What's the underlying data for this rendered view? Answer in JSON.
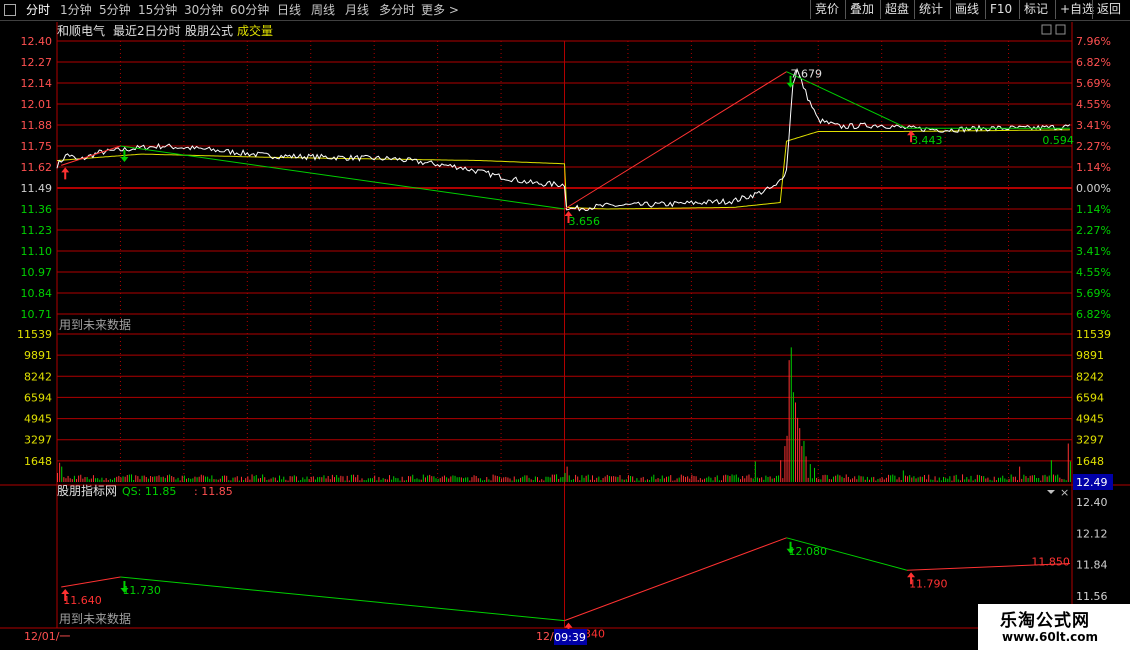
{
  "toolbar": {
    "left": [
      {
        "label": "分时",
        "active": true
      },
      {
        "label": "1分钟"
      },
      {
        "label": "5分钟"
      },
      {
        "label": "15分钟"
      },
      {
        "label": "30分钟"
      },
      {
        "label": "60分钟"
      },
      {
        "label": "日线"
      },
      {
        "label": "周线"
      },
      {
        "label": "月线"
      },
      {
        "label": "多分时"
      },
      {
        "label": "更多 >"
      }
    ],
    "right": [
      "竞价",
      "叠加",
      "超盘",
      "统计",
      "画线",
      "F10",
      "标记",
      "+自选",
      "返回"
    ]
  },
  "header": {
    "stock": "和顺电气",
    "period": "最近2日分时",
    "formula": "股朋公式",
    "volume_label": "成交量"
  },
  "future_data_label": "用到未来数据",
  "indicator": {
    "name": "股朋指标网",
    "qs_label": "QS: 11.85",
    "qs_value": "11.85"
  },
  "time_axis": {
    "day1": "12/01/一",
    "day2": "12/0",
    "cursor": "09:39"
  },
  "watermark": {
    "title": "乐淘公式网",
    "url": "www.60lt.com"
  },
  "colors": {
    "up": "#ff3232",
    "down": "#00d000",
    "grid": "#b00000",
    "price": "#ffffff",
    "avg": "#e0e000",
    "axis_text": "#ff5050"
  },
  "chart_data": [
    {
      "type": "line",
      "name_panel": "price",
      "ylim": [
        10.71,
        12.4
      ],
      "y_ticks": [
        "12.40",
        "12.27",
        "12.14",
        "12.01",
        "11.88",
        "11.75",
        "11.62",
        "11.49",
        "11.36",
        "11.23",
        "11.10",
        "10.97",
        "10.84",
        "10.71"
      ],
      "pct_ticks": [
        "7.96%",
        "6.82%",
        "5.69%",
        "4.55%",
        "3.41%",
        "2.27%",
        "1.14%",
        "0.00%",
        "1.14%",
        "2.27%",
        "3.41%",
        "4.55%",
        "5.69%",
        "6.82%"
      ],
      "prev_close": 11.49,
      "x_range": [
        0,
        480
      ],
      "price_key": [
        [
          0,
          11.63
        ],
        [
          5,
          11.7
        ],
        [
          10,
          11.66
        ],
        [
          20,
          11.71
        ],
        [
          40,
          11.74
        ],
        [
          50,
          11.75
        ],
        [
          70,
          11.73
        ],
        [
          100,
          11.69
        ],
        [
          130,
          11.68
        ],
        [
          160,
          11.67
        ],
        [
          190,
          11.62
        ],
        [
          210,
          11.56
        ],
        [
          225,
          11.52
        ],
        [
          240,
          11.51
        ],
        [
          241,
          11.37
        ],
        [
          243,
          11.36
        ],
        [
          260,
          11.38
        ],
        [
          290,
          11.39
        ],
        [
          320,
          11.41
        ],
        [
          330,
          11.45
        ],
        [
          340,
          11.5
        ],
        [
          345,
          11.6
        ],
        [
          348,
          12.14
        ],
        [
          350,
          12.22
        ],
        [
          355,
          12.05
        ],
        [
          360,
          11.91
        ],
        [
          370,
          11.87
        ],
        [
          390,
          11.88
        ],
        [
          402,
          11.86
        ],
        [
          420,
          11.85
        ],
        [
          440,
          11.86
        ],
        [
          460,
          11.86
        ],
        [
          479,
          11.87
        ]
      ],
      "avg_key": [
        [
          0,
          11.66
        ],
        [
          40,
          11.7
        ],
        [
          100,
          11.68
        ],
        [
          200,
          11.66
        ],
        [
          240,
          11.64
        ],
        [
          241,
          11.37
        ],
        [
          260,
          11.36
        ],
        [
          320,
          11.37
        ],
        [
          342,
          11.4
        ],
        [
          345,
          11.78
        ],
        [
          360,
          11.84
        ],
        [
          400,
          11.84
        ],
        [
          479,
          11.85
        ]
      ],
      "zigzag": [
        [
          2,
          11.63
        ],
        [
          30,
          11.75
        ],
        [
          240,
          11.36
        ],
        [
          345,
          12.21
        ],
        [
          402,
          11.86
        ],
        [
          479,
          11.86
        ]
      ],
      "zigzag_labels": [
        {
          "x": 240,
          "label": "3.656"
        },
        {
          "x": 345,
          "label": "7.679"
        },
        {
          "x": 402,
          "label": "3.443"
        },
        {
          "x": 479,
          "label": "0.594"
        }
      ],
      "buy_arrows": [
        2,
        240,
        402
      ],
      "sell_arrows": [
        30,
        345
      ]
    },
    {
      "type": "bar",
      "name_panel": "volume",
      "ylim": [
        0,
        11539
      ],
      "y_ticks": [
        "11539",
        "9891",
        "8242",
        "6594",
        "4945",
        "3297",
        "1648"
      ],
      "spikes": [
        [
          0,
          700
        ],
        [
          1,
          1500
        ],
        [
          2,
          1200
        ],
        [
          10,
          500
        ],
        [
          60,
          500
        ],
        [
          120,
          400
        ],
        [
          175,
          500
        ],
        [
          236,
          600
        ],
        [
          240,
          700
        ],
        [
          241,
          1200
        ],
        [
          330,
          1600
        ],
        [
          342,
          1700
        ],
        [
          344,
          2800
        ],
        [
          345,
          3600
        ],
        [
          346,
          9500
        ],
        [
          347,
          10500
        ],
        [
          348,
          7000
        ],
        [
          349,
          6200
        ],
        [
          350,
          5000
        ],
        [
          351,
          4200
        ],
        [
          352,
          2800
        ],
        [
          353,
          3200
        ],
        [
          354,
          2000
        ],
        [
          356,
          1400
        ],
        [
          358,
          1100
        ],
        [
          400,
          900
        ],
        [
          455,
          1200
        ],
        [
          470,
          1700
        ],
        [
          478,
          3000
        ],
        [
          479,
          1600
        ]
      ],
      "base_volume": 350
    },
    {
      "type": "line",
      "name_panel": "indicator",
      "ylim": [
        11.56,
        12.4
      ],
      "y_ticks": [
        "12.40",
        "12.12",
        "11.84",
        "11.56"
      ],
      "points": [
        {
          "x": 2,
          "y": 11.64,
          "label": "11.640"
        },
        {
          "x": 30,
          "y": 11.73,
          "label": "11.730"
        },
        {
          "x": 240,
          "y": 11.34,
          "label": "11.340"
        },
        {
          "x": 345,
          "y": 12.08,
          "label": "12.080"
        },
        {
          "x": 402,
          "y": 11.79,
          "label": "11.790"
        },
        {
          "x": 479,
          "y": 11.85,
          "label": "11.850"
        }
      ],
      "buy_arrows": [
        2,
        240,
        402
      ],
      "sell_arrows": [
        30,
        345
      ]
    }
  ]
}
